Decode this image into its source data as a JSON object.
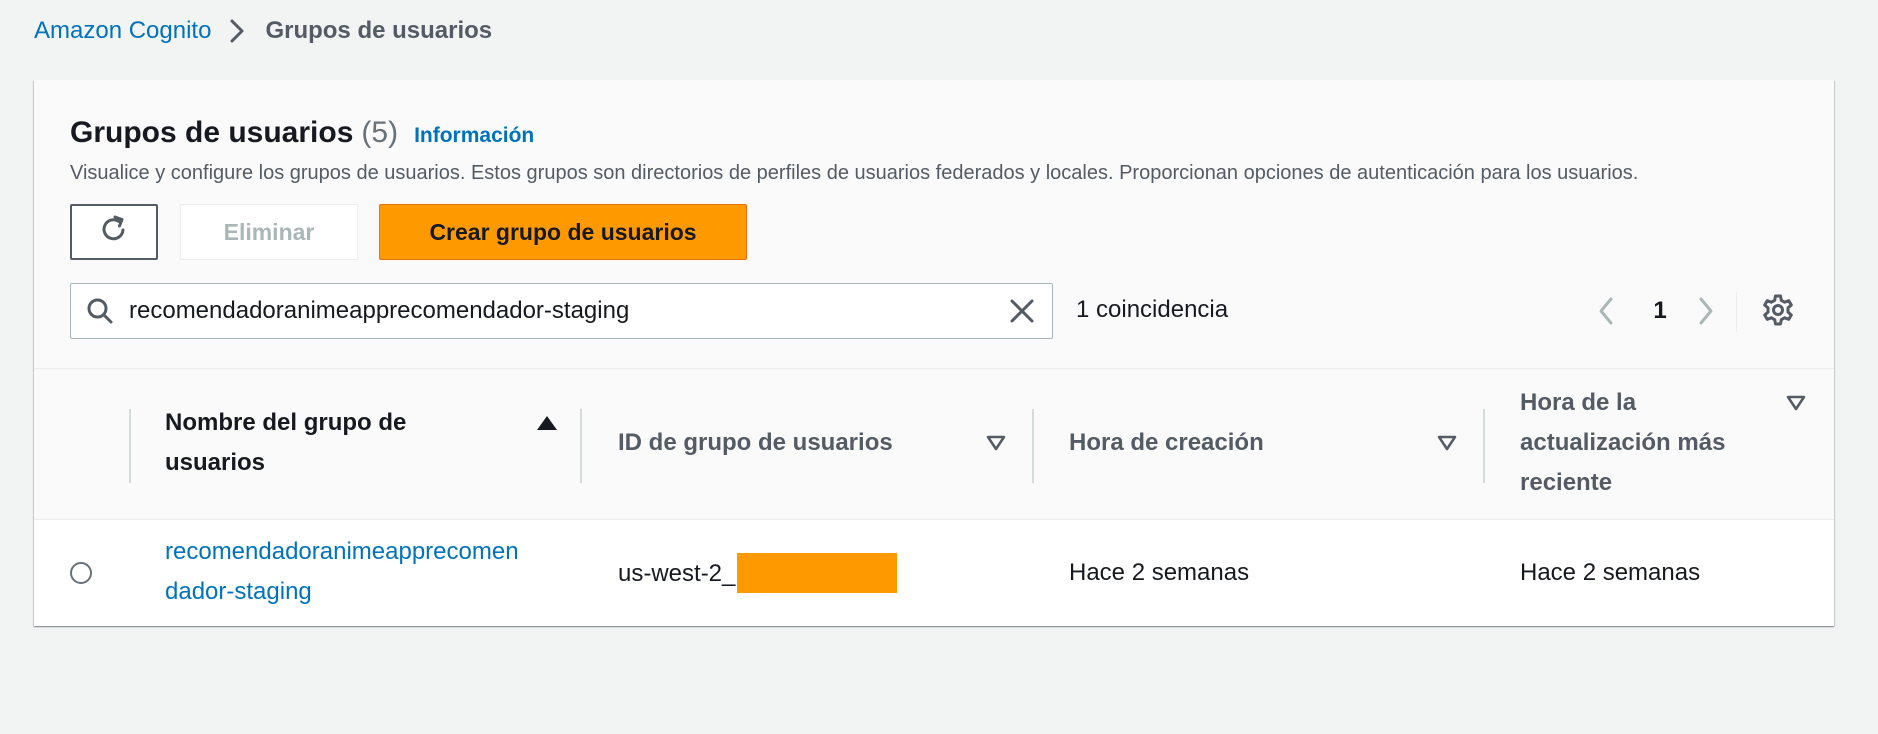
{
  "breadcrumb": {
    "root": "Amazon Cognito",
    "current": "Grupos de usuarios"
  },
  "header": {
    "title": "Grupos de usuarios",
    "count": "(5)",
    "info_link": "Información",
    "description": "Visualice y configure los grupos de usuarios. Estos grupos son directorios de perfiles de usuarios federados y locales. Proporcionan opciones de autenticación para los usuarios."
  },
  "toolbar": {
    "refresh_icon": "refresh-icon",
    "delete_label": "Eliminar",
    "create_label": "Crear grupo de usuarios"
  },
  "search": {
    "value": "recomendadoranimeapprecomendador-staging",
    "matches": "1 coincidencia"
  },
  "pagination": {
    "current_page": "1"
  },
  "table": {
    "columns": [
      {
        "label_line1": "Nombre del grupo de",
        "label_line2": "usuarios",
        "sort": "ascending"
      },
      {
        "label": "ID de grupo de usuarios",
        "sort": "none"
      },
      {
        "label": "Hora de creación",
        "sort": "none"
      },
      {
        "label_line1": "Hora de la",
        "label_line2": "actualización más",
        "label_line3": "reciente",
        "sort": "none"
      }
    ],
    "rows": [
      {
        "name_line1": "recomendadoranimeapprecomen",
        "name_line2": "dador-staging",
        "id_prefix": "us-west-2_",
        "created": "Hace 2 semanas",
        "updated": "Hace 2 semanas"
      }
    ]
  },
  "colors": {
    "link": "#0073bb",
    "primary_button": "#ff9900",
    "redaction": "#ff9900"
  }
}
